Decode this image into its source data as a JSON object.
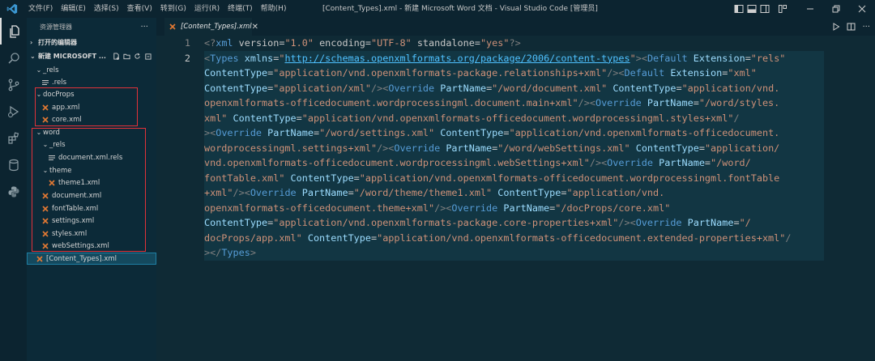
{
  "titlebar": {
    "menus": [
      "文件(F)",
      "编辑(E)",
      "选择(S)",
      "查看(V)",
      "转到(G)",
      "运行(R)",
      "终端(T)",
      "帮助(H)"
    ],
    "title": "[Content_Types].xml - 新建 Microsoft Word 文档 - Visual Studio Code [管理员]"
  },
  "sidebar": {
    "header": "资源管理器",
    "more": "···",
    "open_editors": "打开的编辑器",
    "workspace": "新建 MICROSOFT ..."
  },
  "tree": [
    {
      "label": "_rels",
      "type": "folder",
      "open": true
    },
    {
      "label": ".rels",
      "type": "lines"
    },
    {
      "label": "docProps",
      "type": "folder",
      "open": true
    },
    {
      "label": "app.xml",
      "type": "xml"
    },
    {
      "label": "core.xml",
      "type": "xml"
    },
    {
      "label": "word",
      "type": "folder",
      "open": true
    },
    {
      "label": "_rels",
      "type": "folder",
      "open": true
    },
    {
      "label": "document.xml.rels",
      "type": "lines"
    },
    {
      "label": "theme",
      "type": "folder",
      "open": true
    },
    {
      "label": "theme1.xml",
      "type": "xml"
    },
    {
      "label": "document.xml",
      "type": "xml"
    },
    {
      "label": "fontTable.xml",
      "type": "xml"
    },
    {
      "label": "settings.xml",
      "type": "xml"
    },
    {
      "label": "styles.xml",
      "type": "xml"
    },
    {
      "label": "webSettings.xml",
      "type": "xml"
    },
    {
      "label": "[Content_Types].xml",
      "type": "xml",
      "selected": true
    }
  ],
  "editor": {
    "tab_label": "[Content_Types].xml",
    "tab_close": "✕",
    "line_numbers": [
      "1",
      "2"
    ]
  },
  "code_lines": [
    [
      [
        "punc",
        "<?"
      ],
      [
        "tag",
        "xml"
      ],
      [
        "text",
        " version="
      ],
      [
        "val",
        "\"1.0\""
      ],
      [
        "text",
        " encoding="
      ],
      [
        "val",
        "\"UTF-8\""
      ],
      [
        "text",
        " standalone="
      ],
      [
        "val",
        "\"yes\""
      ],
      [
        "punc",
        "?>"
      ]
    ],
    [
      [
        "punc",
        "<"
      ],
      [
        "tag",
        "Types"
      ],
      [
        "attr",
        " xmlns"
      ],
      [
        "text",
        "="
      ],
      [
        "val",
        "\""
      ],
      [
        "url",
        "http://schemas.openxmlformats.org/package/2006/content-types"
      ],
      [
        "val",
        "\""
      ],
      [
        "punc",
        "><"
      ],
      [
        "tag",
        "Default"
      ],
      [
        "attr",
        " Extension"
      ],
      [
        "text",
        "="
      ],
      [
        "val",
        "\"rels\""
      ]
    ],
    [
      [
        "attr",
        "ContentType"
      ],
      [
        "text",
        "="
      ],
      [
        "val",
        "\"application/vnd.openxmlformats-package.relationships+xml\""
      ],
      [
        "punc",
        "/><"
      ],
      [
        "tag",
        "Default"
      ],
      [
        "attr",
        " Extension"
      ],
      [
        "text",
        "="
      ],
      [
        "val",
        "\"xml\""
      ]
    ],
    [
      [
        "attr",
        "ContentType"
      ],
      [
        "text",
        "="
      ],
      [
        "val",
        "\"application/xml\""
      ],
      [
        "punc",
        "/><"
      ],
      [
        "tag",
        "Override"
      ],
      [
        "attr",
        " PartName"
      ],
      [
        "text",
        "="
      ],
      [
        "val",
        "\"/word/document.xml\""
      ],
      [
        "attr",
        " ContentType"
      ],
      [
        "text",
        "="
      ],
      [
        "val",
        "\"application/vnd."
      ]
    ],
    [
      [
        "val",
        "openxmlformats-officedocument.wordprocessingml.document.main+xml\""
      ],
      [
        "punc",
        "/><"
      ],
      [
        "tag",
        "Override"
      ],
      [
        "attr",
        " PartName"
      ],
      [
        "text",
        "="
      ],
      [
        "val",
        "\"/word/styles."
      ]
    ],
    [
      [
        "val",
        "xml\""
      ],
      [
        "attr",
        " ContentType"
      ],
      [
        "text",
        "="
      ],
      [
        "val",
        "\"application/vnd.openxmlformats-officedocument.wordprocessingml.styles+xml\""
      ],
      [
        "punc",
        "/"
      ]
    ],
    [
      [
        "punc",
        "><"
      ],
      [
        "tag",
        "Override"
      ],
      [
        "attr",
        " PartName"
      ],
      [
        "text",
        "="
      ],
      [
        "val",
        "\"/word/settings.xml\""
      ],
      [
        "attr",
        " ContentType"
      ],
      [
        "text",
        "="
      ],
      [
        "val",
        "\"application/vnd.openxmlformats-officedocument."
      ]
    ],
    [
      [
        "val",
        "wordprocessingml.settings+xml\""
      ],
      [
        "punc",
        "/><"
      ],
      [
        "tag",
        "Override"
      ],
      [
        "attr",
        " PartName"
      ],
      [
        "text",
        "="
      ],
      [
        "val",
        "\"/word/webSettings.xml\""
      ],
      [
        "attr",
        " ContentType"
      ],
      [
        "text",
        "="
      ],
      [
        "val",
        "\"application/"
      ]
    ],
    [
      [
        "val",
        "vnd.openxmlformats-officedocument.wordprocessingml.webSettings+xml\""
      ],
      [
        "punc",
        "/><"
      ],
      [
        "tag",
        "Override"
      ],
      [
        "attr",
        " PartName"
      ],
      [
        "text",
        "="
      ],
      [
        "val",
        "\"/word/"
      ]
    ],
    [
      [
        "val",
        "fontTable.xml\""
      ],
      [
        "attr",
        " ContentType"
      ],
      [
        "text",
        "="
      ],
      [
        "val",
        "\"application/vnd.openxmlformats-officedocument.wordprocessingml.fontTable"
      ]
    ],
    [
      [
        "val",
        "+xml\""
      ],
      [
        "punc",
        "/><"
      ],
      [
        "tag",
        "Override"
      ],
      [
        "attr",
        " PartName"
      ],
      [
        "text",
        "="
      ],
      [
        "val",
        "\"/word/theme/theme1.xml\""
      ],
      [
        "attr",
        " ContentType"
      ],
      [
        "text",
        "="
      ],
      [
        "val",
        "\"application/vnd."
      ]
    ],
    [
      [
        "val",
        "openxmlformats-officedocument.theme+xml\""
      ],
      [
        "punc",
        "/><"
      ],
      [
        "tag",
        "Override"
      ],
      [
        "attr",
        " PartName"
      ],
      [
        "text",
        "="
      ],
      [
        "val",
        "\"/docProps/core.xml\""
      ]
    ],
    [
      [
        "attr",
        "ContentType"
      ],
      [
        "text",
        "="
      ],
      [
        "val",
        "\"application/vnd.openxmlformats-package.core-properties+xml\""
      ],
      [
        "punc",
        "/><"
      ],
      [
        "tag",
        "Override"
      ],
      [
        "attr",
        " PartName"
      ],
      [
        "text",
        "="
      ],
      [
        "val",
        "\"/"
      ]
    ],
    [
      [
        "val",
        "docProps/app.xml\""
      ],
      [
        "attr",
        " ContentType"
      ],
      [
        "text",
        "="
      ],
      [
        "val",
        "\"application/vnd.openxmlformats-officedocument.extended-properties+xml\""
      ],
      [
        "punc",
        "/"
      ]
    ],
    [
      [
        "punc",
        "></"
      ],
      [
        "tag",
        "Types"
      ],
      [
        "punc",
        ">"
      ]
    ]
  ],
  "colors": {
    "tag": "#569cd6",
    "attr": "#9cdcfe",
    "value": "#ce9178",
    "highlight_box": "#e2323a",
    "xml_icon": "#e37933"
  }
}
